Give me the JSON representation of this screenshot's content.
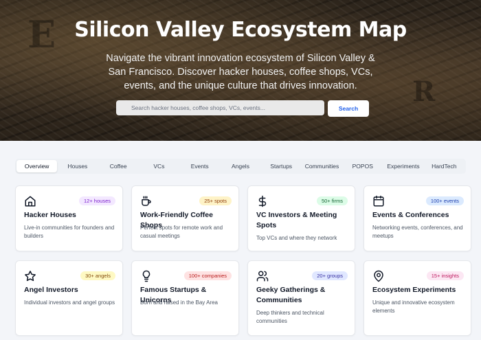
{
  "hero": {
    "title": "Silicon Valley Ecosystem Map",
    "subtitle": "Navigate the vibrant innovation ecosystem of Silicon Valley & San Francisco. Discover hacker houses, coffee shops, VCs, events, and the unique culture that drives innovation.",
    "search": {
      "placeholder": "Search hacker houses, coffee shops, VCs, events...",
      "button_label": "Search"
    }
  },
  "tabs": [
    {
      "label": "Overview",
      "active": true
    },
    {
      "label": "Houses"
    },
    {
      "label": "Coffee"
    },
    {
      "label": "VCs"
    },
    {
      "label": "Events"
    },
    {
      "label": "Angels"
    },
    {
      "label": "Startups"
    },
    {
      "label": "Communities"
    },
    {
      "label": "POPOS"
    },
    {
      "label": "Experiments"
    },
    {
      "label": "HardTech"
    }
  ],
  "cards": [
    {
      "icon": "house-icon",
      "title": "Hacker Houses",
      "badge": "12+ houses",
      "badge_bg": "#f3e8ff",
      "badge_fg": "#7e22ce",
      "desc": "Live-in communities for founders and builders"
    },
    {
      "icon": "coffee-icon",
      "title": "Work-Friendly Coffee Shops",
      "badge": "25+ spots",
      "badge_bg": "#fef3c7",
      "badge_fg": "#92400e",
      "desc": "Perfect spots for remote work and casual meetings"
    },
    {
      "icon": "dollar-icon",
      "title": "VC Investors & Meeting Spots",
      "badge": "50+ firms",
      "badge_bg": "#dcfce7",
      "badge_fg": "#166534",
      "desc": "Top VCs and where they network"
    },
    {
      "icon": "calendar-icon",
      "title": "Events & Conferences",
      "badge": "100+ events",
      "badge_bg": "#dbeafe",
      "badge_fg": "#1e40af",
      "desc": "Networking events, conferences, and meetups"
    },
    {
      "icon": "star-icon",
      "title": "Angel Investors",
      "badge": "30+ angels",
      "badge_bg": "#fef9c3",
      "badge_fg": "#854d0e",
      "desc": "Individual investors and angel groups"
    },
    {
      "icon": "lightbulb-icon",
      "title": "Famous Startups & Unicorns",
      "badge": "100+ companies",
      "badge_bg": "#fee2e2",
      "badge_fg": "#b91c1c",
      "desc": "Born and raised in the Bay Area"
    },
    {
      "icon": "users-icon",
      "title": "Geeky Gatherings & Communities",
      "badge": "20+ groups",
      "badge_bg": "#e0e7ff",
      "badge_fg": "#3730a3",
      "desc": "Deep thinkers and technical communities"
    },
    {
      "icon": "map-pin-icon",
      "title": "Ecosystem Experiments",
      "badge": "15+ insights",
      "badge_bg": "#fce7f3",
      "badge_fg": "#be185d",
      "desc": "Unique and innovative ecosystem elements"
    }
  ]
}
